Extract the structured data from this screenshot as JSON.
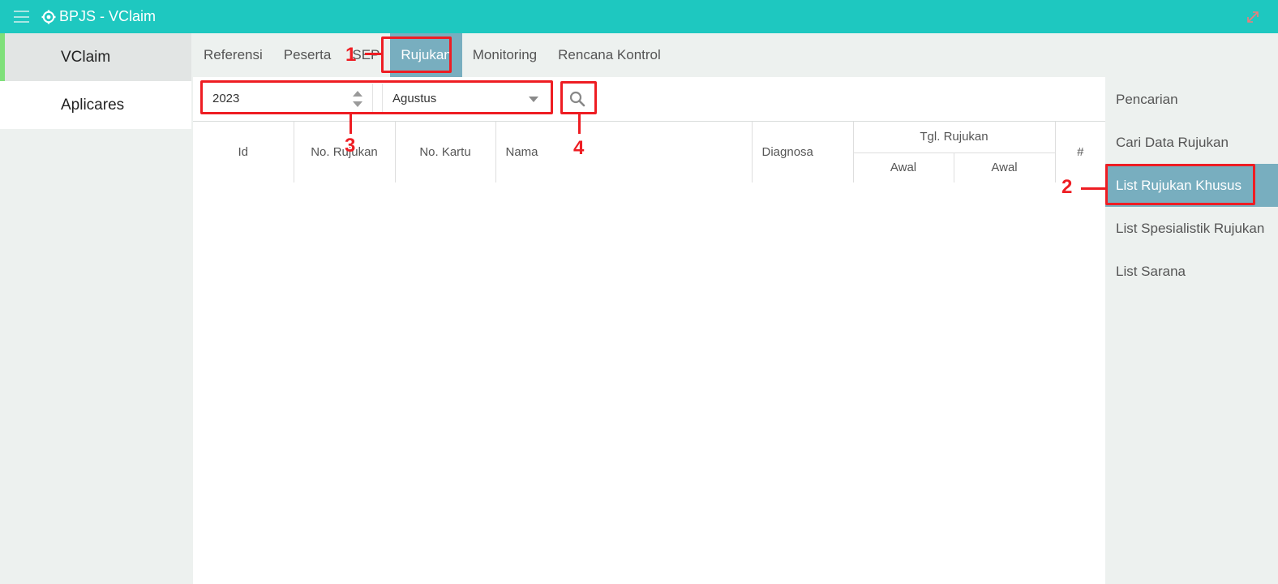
{
  "app": {
    "title": "BPJS - VClaim",
    "icons": {
      "menu": "hamburger-icon",
      "logo": "gear-icon",
      "expand": "expand-icon"
    }
  },
  "left_nav": {
    "items": [
      {
        "label": "VClaim",
        "selected": true
      },
      {
        "label": "Aplicares",
        "selected": false
      }
    ]
  },
  "tabs": [
    {
      "label": "Referensi",
      "active": false
    },
    {
      "label": "Peserta",
      "active": false
    },
    {
      "label": "SEP",
      "active": false
    },
    {
      "label": "Rujukan",
      "active": true
    },
    {
      "label": "Monitoring",
      "active": false
    },
    {
      "label": "Rencana Kontrol",
      "active": false
    }
  ],
  "filters": {
    "year": "2023",
    "month": "Agustus",
    "search_icon": "search-icon"
  },
  "table": {
    "columns": {
      "id": "Id",
      "no_rujukan": "No. Rujukan",
      "no_kartu": "No. Kartu",
      "nama": "Nama",
      "diagnosa": "Diagnosa",
      "tgl_rujukan": "Tgl. Rujukan",
      "awal_1": "Awal",
      "awal_2": "Awal",
      "action": "#"
    },
    "rows": []
  },
  "right_menu": [
    {
      "label": "Pencarian",
      "active": false
    },
    {
      "label": "Cari Data Rujukan",
      "active": false
    },
    {
      "label": "List Rujukan Khusus",
      "active": true
    },
    {
      "label": "List Spesialistik Rujukan",
      "active": false
    },
    {
      "label": "List Sarana",
      "active": false
    }
  ],
  "annotations": {
    "n1": "1",
    "n2": "2",
    "n3": "3",
    "n4": "4"
  },
  "colors": {
    "topbar": "#1ec8c0",
    "active_tab": "#78aebf",
    "annotation": "#ee1d23",
    "selected_marker": "#7fe07a"
  }
}
